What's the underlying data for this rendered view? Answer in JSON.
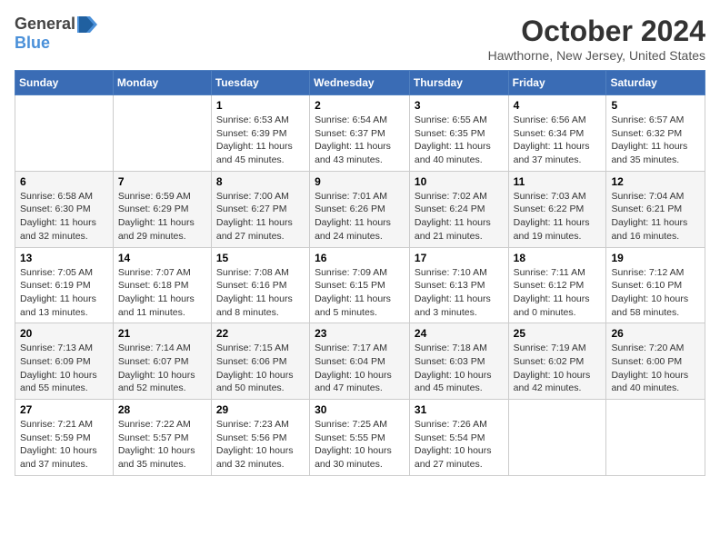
{
  "header": {
    "logo_general": "General",
    "logo_blue": "Blue",
    "month_title": "October 2024",
    "location": "Hawthorne, New Jersey, United States"
  },
  "days_of_week": [
    "Sunday",
    "Monday",
    "Tuesday",
    "Wednesday",
    "Thursday",
    "Friday",
    "Saturday"
  ],
  "weeks": [
    [
      {
        "day": "",
        "info": ""
      },
      {
        "day": "",
        "info": ""
      },
      {
        "day": "1",
        "info": "Sunrise: 6:53 AM\nSunset: 6:39 PM\nDaylight: 11 hours and 45 minutes."
      },
      {
        "day": "2",
        "info": "Sunrise: 6:54 AM\nSunset: 6:37 PM\nDaylight: 11 hours and 43 minutes."
      },
      {
        "day": "3",
        "info": "Sunrise: 6:55 AM\nSunset: 6:35 PM\nDaylight: 11 hours and 40 minutes."
      },
      {
        "day": "4",
        "info": "Sunrise: 6:56 AM\nSunset: 6:34 PM\nDaylight: 11 hours and 37 minutes."
      },
      {
        "day": "5",
        "info": "Sunrise: 6:57 AM\nSunset: 6:32 PM\nDaylight: 11 hours and 35 minutes."
      }
    ],
    [
      {
        "day": "6",
        "info": "Sunrise: 6:58 AM\nSunset: 6:30 PM\nDaylight: 11 hours and 32 minutes."
      },
      {
        "day": "7",
        "info": "Sunrise: 6:59 AM\nSunset: 6:29 PM\nDaylight: 11 hours and 29 minutes."
      },
      {
        "day": "8",
        "info": "Sunrise: 7:00 AM\nSunset: 6:27 PM\nDaylight: 11 hours and 27 minutes."
      },
      {
        "day": "9",
        "info": "Sunrise: 7:01 AM\nSunset: 6:26 PM\nDaylight: 11 hours and 24 minutes."
      },
      {
        "day": "10",
        "info": "Sunrise: 7:02 AM\nSunset: 6:24 PM\nDaylight: 11 hours and 21 minutes."
      },
      {
        "day": "11",
        "info": "Sunrise: 7:03 AM\nSunset: 6:22 PM\nDaylight: 11 hours and 19 minutes."
      },
      {
        "day": "12",
        "info": "Sunrise: 7:04 AM\nSunset: 6:21 PM\nDaylight: 11 hours and 16 minutes."
      }
    ],
    [
      {
        "day": "13",
        "info": "Sunrise: 7:05 AM\nSunset: 6:19 PM\nDaylight: 11 hours and 13 minutes."
      },
      {
        "day": "14",
        "info": "Sunrise: 7:07 AM\nSunset: 6:18 PM\nDaylight: 11 hours and 11 minutes."
      },
      {
        "day": "15",
        "info": "Sunrise: 7:08 AM\nSunset: 6:16 PM\nDaylight: 11 hours and 8 minutes."
      },
      {
        "day": "16",
        "info": "Sunrise: 7:09 AM\nSunset: 6:15 PM\nDaylight: 11 hours and 5 minutes."
      },
      {
        "day": "17",
        "info": "Sunrise: 7:10 AM\nSunset: 6:13 PM\nDaylight: 11 hours and 3 minutes."
      },
      {
        "day": "18",
        "info": "Sunrise: 7:11 AM\nSunset: 6:12 PM\nDaylight: 11 hours and 0 minutes."
      },
      {
        "day": "19",
        "info": "Sunrise: 7:12 AM\nSunset: 6:10 PM\nDaylight: 10 hours and 58 minutes."
      }
    ],
    [
      {
        "day": "20",
        "info": "Sunrise: 7:13 AM\nSunset: 6:09 PM\nDaylight: 10 hours and 55 minutes."
      },
      {
        "day": "21",
        "info": "Sunrise: 7:14 AM\nSunset: 6:07 PM\nDaylight: 10 hours and 52 minutes."
      },
      {
        "day": "22",
        "info": "Sunrise: 7:15 AM\nSunset: 6:06 PM\nDaylight: 10 hours and 50 minutes."
      },
      {
        "day": "23",
        "info": "Sunrise: 7:17 AM\nSunset: 6:04 PM\nDaylight: 10 hours and 47 minutes."
      },
      {
        "day": "24",
        "info": "Sunrise: 7:18 AM\nSunset: 6:03 PM\nDaylight: 10 hours and 45 minutes."
      },
      {
        "day": "25",
        "info": "Sunrise: 7:19 AM\nSunset: 6:02 PM\nDaylight: 10 hours and 42 minutes."
      },
      {
        "day": "26",
        "info": "Sunrise: 7:20 AM\nSunset: 6:00 PM\nDaylight: 10 hours and 40 minutes."
      }
    ],
    [
      {
        "day": "27",
        "info": "Sunrise: 7:21 AM\nSunset: 5:59 PM\nDaylight: 10 hours and 37 minutes."
      },
      {
        "day": "28",
        "info": "Sunrise: 7:22 AM\nSunset: 5:57 PM\nDaylight: 10 hours and 35 minutes."
      },
      {
        "day": "29",
        "info": "Sunrise: 7:23 AM\nSunset: 5:56 PM\nDaylight: 10 hours and 32 minutes."
      },
      {
        "day": "30",
        "info": "Sunrise: 7:25 AM\nSunset: 5:55 PM\nDaylight: 10 hours and 30 minutes."
      },
      {
        "day": "31",
        "info": "Sunrise: 7:26 AM\nSunset: 5:54 PM\nDaylight: 10 hours and 27 minutes."
      },
      {
        "day": "",
        "info": ""
      },
      {
        "day": "",
        "info": ""
      }
    ]
  ]
}
